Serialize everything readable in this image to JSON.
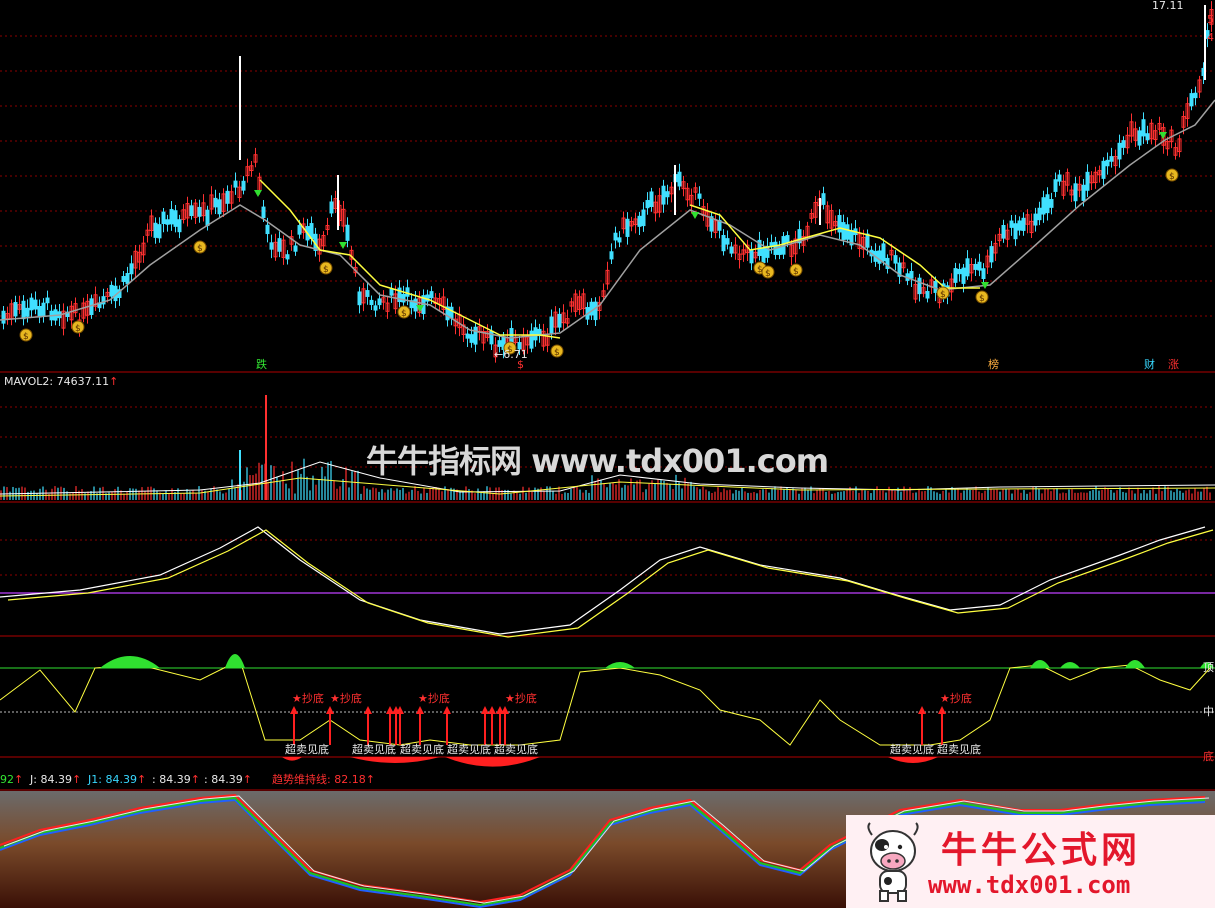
{
  "colors": {
    "bg": "#000000",
    "up": "#ff3030",
    "down": "#40e0ff",
    "ma_yellow": "#ffff40",
    "ma_gray": "#a0a0a0",
    "grid": "#8b0000",
    "rsi_green": "#30e030",
    "purple": "#c040ff",
    "brand_red": "#e3172b"
  },
  "price_panel": {
    "top_value": "17.11",
    "edge_marks": [
      "5",
      "4"
    ],
    "low_label": "6.71",
    "events": [
      {
        "text": "跌",
        "color": "green"
      },
      {
        "text": "$",
        "color": "red"
      },
      {
        "text": "榜",
        "color": "orange"
      },
      {
        "text": "财",
        "color": "cyan"
      },
      {
        "text": "涨",
        "color": "red"
      }
    ],
    "money_icon": "money-bag-icon"
  },
  "volume_panel": {
    "title": "MAVOL2: 74637.11",
    "arrow": "↑"
  },
  "watermark": {
    "text": "牛牛指标网 www.tdx001.com"
  },
  "signal_panel": {
    "buy_label": "★抄底",
    "oversold_label": "超卖见底",
    "right_labels": [
      "顶",
      "中",
      "底"
    ]
  },
  "kdj_panel": {
    "labels": [
      {
        "text": "92",
        "color": "green"
      },
      {
        "text": "J: 84.39",
        "color": "white"
      },
      {
        "text": "J1: 84.39",
        "color": "cyan"
      },
      {
        "text": ": 84.39",
        "color": "white"
      },
      {
        "text": ": 84.39",
        "color": "white"
      },
      {
        "text": "趋势维持线: 82.18",
        "color": "red"
      }
    ],
    "arrow": "↑"
  },
  "logo": {
    "title": "牛牛公式网",
    "url": "www.tdx001.com",
    "icon": "cow-mascot-icon"
  }
}
